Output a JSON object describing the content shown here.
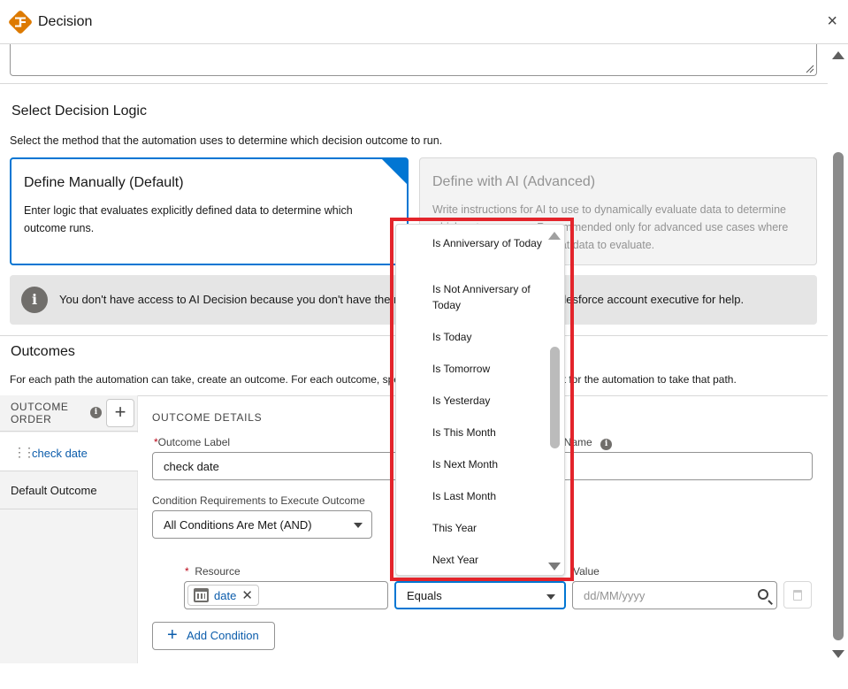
{
  "header": {
    "title": "Decision",
    "close_glyph": "×"
  },
  "logic": {
    "title": "Select Decision Logic",
    "description": "Select the method that the automation uses to determine which decision outcome to run.",
    "manual": {
      "title": "Define Manually (Default)",
      "body": "Enter logic that evaluates explicitly defined data to determine which outcome runs."
    },
    "ai": {
      "title": "Define with AI (Advanced)",
      "body": "Write instructions for AI to use to dynamically evaluate data to determine which outcome runs. Recommended only for advanced use cases where you don't know exactly what data to evaluate."
    }
  },
  "notice": {
    "icon": "info-icon",
    "text": "You don't have access to AI Decision because you don't have the required license. Contact your Salesforce account executive for help."
  },
  "outcomes": {
    "title": "Outcomes",
    "description": "For each path the automation can take, create an outcome. For each outcome, specify the conditions that must be met for the automation to take that path.",
    "order_label": "OUTCOME ORDER",
    "add_glyph": "+",
    "items": [
      {
        "label": "check date"
      },
      {
        "label": "Default Outcome"
      }
    ]
  },
  "details": {
    "title": "OUTCOME DETAILS",
    "outcome_label_label": "Outcome Label",
    "outcome_label_value": "check date",
    "api_name_label": "API Name",
    "condition_req_label": "Condition Requirements to Execute Outcome",
    "condition_req_value": "All Conditions Are Met (AND)",
    "resource_label": "Resource",
    "resource_value": "date",
    "operator_value": "Equals",
    "value_label": "Value",
    "value_placeholder": "dd/MM/yyyy",
    "add_condition_label": "Add Condition"
  },
  "operator_dropdown": {
    "options": [
      "Is Anniversary of Today",
      "Is Not Anniversary of Today",
      "Is Today",
      "Is Tomorrow",
      "Is Yesterday",
      "Is This Month",
      "Is Next Month",
      "Is Last Month",
      "This Year",
      "Next Year"
    ]
  },
  "colors": {
    "brand": "#0176d3",
    "link": "#0b5cab",
    "highlight": "#e3242b",
    "logo": "#dd7a01"
  }
}
